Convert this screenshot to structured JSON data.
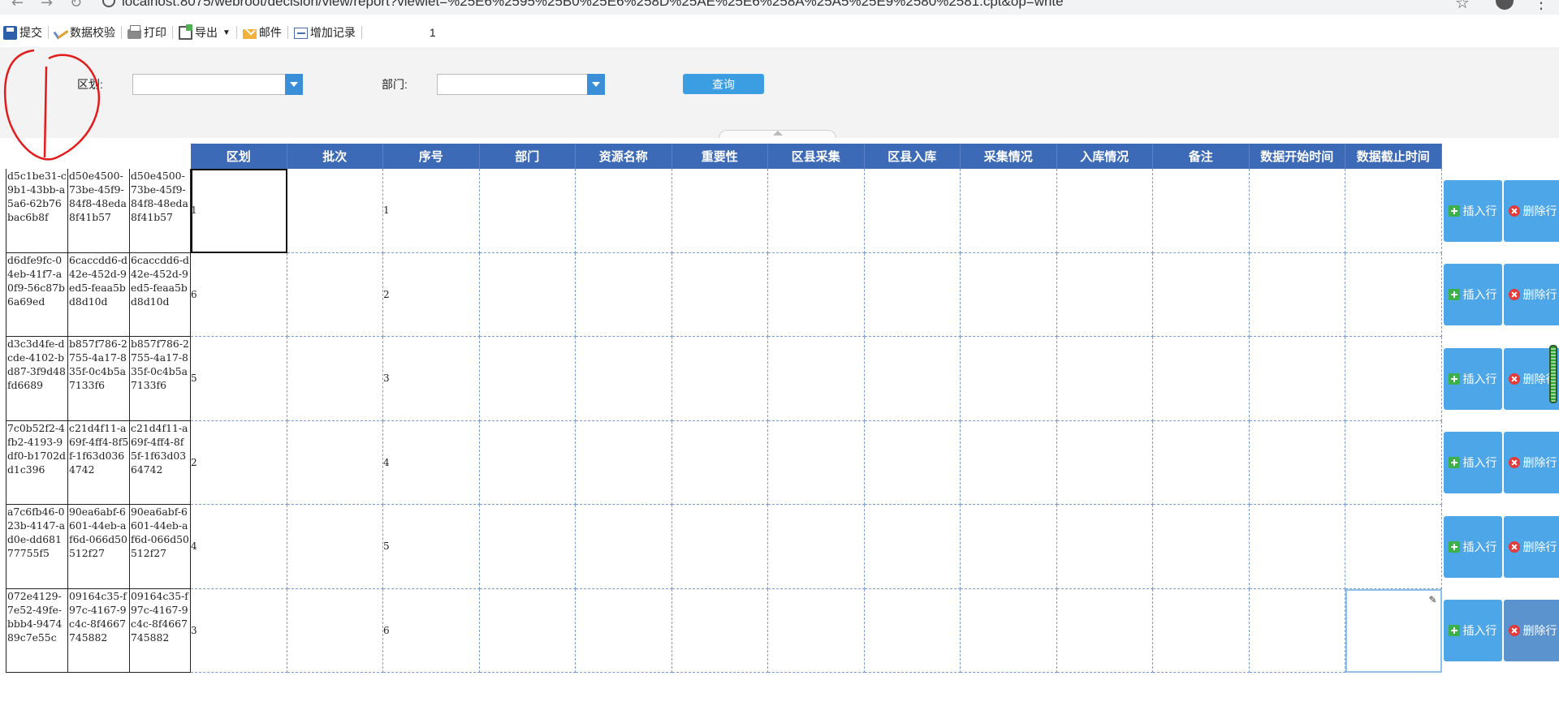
{
  "browser": {
    "url": "localhost:8075/webroot/decision/view/report?viewlet=%25E6%2595%25B0%25E6%258D%25AE%25E6%258A%25A5%25E9%2580%2581.cpt&op=write"
  },
  "toolbar": {
    "submit": "提交",
    "validate": "数据校验",
    "print": "打印",
    "export": "导出",
    "mail": "邮件",
    "add_record": "增加记录",
    "page_number": "1"
  },
  "filter": {
    "district_label": "区划:",
    "district_value": "",
    "department_label": "部门:",
    "department_value": "",
    "query_button": "查询"
  },
  "table": {
    "headers": [
      "区划",
      "批次",
      "序号",
      "部门",
      "资源名称",
      "重要性",
      "区县采集",
      "区县入库",
      "采集情况",
      "入库情况",
      "备注",
      "数据开始时间",
      "数据截止时间"
    ],
    "rows": [
      {
        "id1": "d5c1be31-c9b1-43bb-a5a6-62b76bac6b8f",
        "id2": "d50e4500-73be-45f9-84f8-48eda8f41b57",
        "id3": "d50e4500-73be-45f9-84f8-48eda8f41b57",
        "district": "1",
        "seq": "1"
      },
      {
        "id1": "d6dfe9fc-04eb-41f7-a0f9-56c87b6a69ed",
        "id2": "6caccdd6-d42e-452d-9ed5-feaa5bd8d10d",
        "id3": "6caccdd6-d42e-452d-9ed5-feaa5bd8d10d",
        "district": "6",
        "seq": "2"
      },
      {
        "id1": "d3c3d4fe-dcde-4102-bd87-3f9d48fd6689",
        "id2": "b857f786-2755-4a17-835f-0c4b5a7133f6",
        "id3": "b857f786-2755-4a17-835f-0c4b5a7133f6",
        "district": "5",
        "seq": "3"
      },
      {
        "id1": "7c0b52f2-4fb2-4193-9df0-b1702dd1c396",
        "id2": "c21d4f11-a69f-4ff4-8f5f-1f63d0364742",
        "id3": "c21d4f11-a69f-4ff4-8f5f-1f63d0364742",
        "district": "2",
        "seq": "4"
      },
      {
        "id1": "a7c6fb46-023b-4147-ad0e-dd68177755f5",
        "id2": "90ea6abf-6601-44eb-af6d-066d50512f27",
        "id3": "90ea6abf-6601-44eb-af6d-066d50512f27",
        "district": "4",
        "seq": "5"
      },
      {
        "id1": "072e4129-7e52-49fe-bbb4-947489c7e55c",
        "id2": "09164c35-f97c-4167-9c4c-8f4667745882",
        "id3": "09164c35-f97c-4167-9c4c-8f4667745882",
        "district": "3",
        "seq": "6"
      }
    ],
    "insert_row": "插入行",
    "delete_row": "删除行"
  },
  "colors": {
    "header_bg": "#3d6ab6",
    "button_bg": "#4da6e8",
    "annotation_red": "#e31b1b"
  }
}
